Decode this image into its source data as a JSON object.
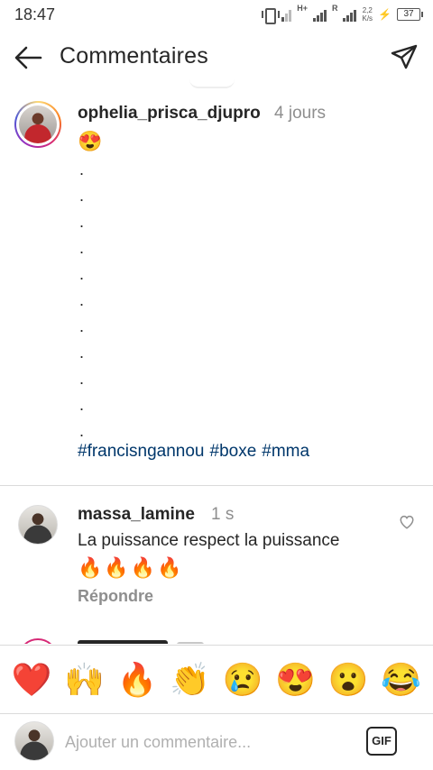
{
  "status_bar": {
    "time": "18:47",
    "network_type": "H+",
    "network_type_2": "R",
    "speed_value": "2,2",
    "speed_unit": "K/s",
    "battery_level": "37"
  },
  "header": {
    "title": "Commentaires",
    "back_icon": "arrow-left-icon",
    "share_icon": "paper-plane-icon"
  },
  "caption": {
    "username": "ophelia_prisca_djupro",
    "time": "4 jours",
    "emoji": "😍",
    "dots": [
      ".",
      ".",
      ".",
      ".",
      ".",
      ".",
      ".",
      ".",
      ".",
      ".",
      "."
    ],
    "hashtags": [
      "#francisngannou",
      "#boxe",
      "#mma"
    ]
  },
  "comment": {
    "username": "massa_lamine",
    "time": "1 s",
    "text": "La puissance respect la puissance",
    "emojis": "🔥🔥🔥🔥",
    "reply_label": "Répondre",
    "like_icon": "heart-outline-icon"
  },
  "emoji_bar": [
    {
      "emoji": "❤️",
      "name": "red-heart"
    },
    {
      "emoji": "🙌",
      "name": "raising-hands"
    },
    {
      "emoji": "🔥",
      "name": "fire"
    },
    {
      "emoji": "👏",
      "name": "clapping-hands"
    },
    {
      "emoji": "😢",
      "name": "crying-face"
    },
    {
      "emoji": "😍",
      "name": "heart-eyes"
    },
    {
      "emoji": "😮",
      "name": "open-mouth"
    },
    {
      "emoji": "😂",
      "name": "tears-of-joy"
    }
  ],
  "input_bar": {
    "placeholder": "Ajouter un commentaire...",
    "gif_label": "GIF"
  },
  "colors": {
    "hashtag": "#00376b",
    "secondary_text": "#8e8e8e",
    "divider": "#dbdbdb"
  }
}
